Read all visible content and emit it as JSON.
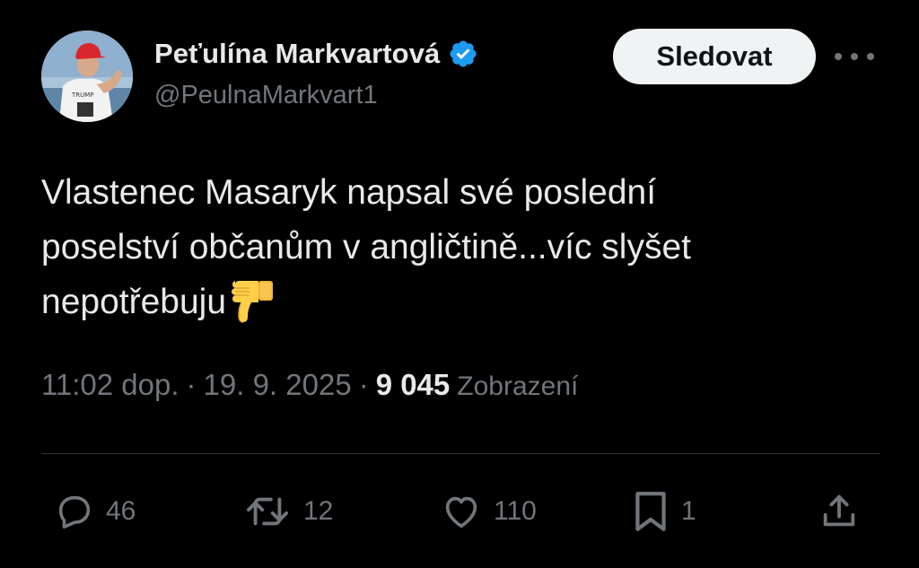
{
  "author": {
    "display_name": "Peťulína Markvartová",
    "handle": "@PeulnaMarkvart1",
    "avatar_icon": "profile-photo",
    "verified_icon": "verified-badge-icon",
    "verified_color": "#1d9bf0"
  },
  "follow_label": "Sledovat",
  "more_icon": "more-horizontal-icon",
  "tweet": {
    "lines": [
      "Vlastenec Masaryk napsal své poslední",
      "poselství občanům v angličtině...víc slyšet",
      "nepotřebuju"
    ],
    "emoji": "thumbs-down-icon"
  },
  "meta": {
    "time": "11:02 dop.",
    "separator": "·",
    "date": "19. 9. 2025",
    "views_count": "9 045",
    "views_label": "Zobrazení"
  },
  "actions": {
    "replies": "46",
    "reposts": "12",
    "likes": "110",
    "bookmarks": "1"
  },
  "colors": {
    "background": "#000000",
    "text": "#e7e9ea",
    "muted": "#71767b",
    "follow_bg": "#eff3f4",
    "divider": "#2f3336"
  }
}
